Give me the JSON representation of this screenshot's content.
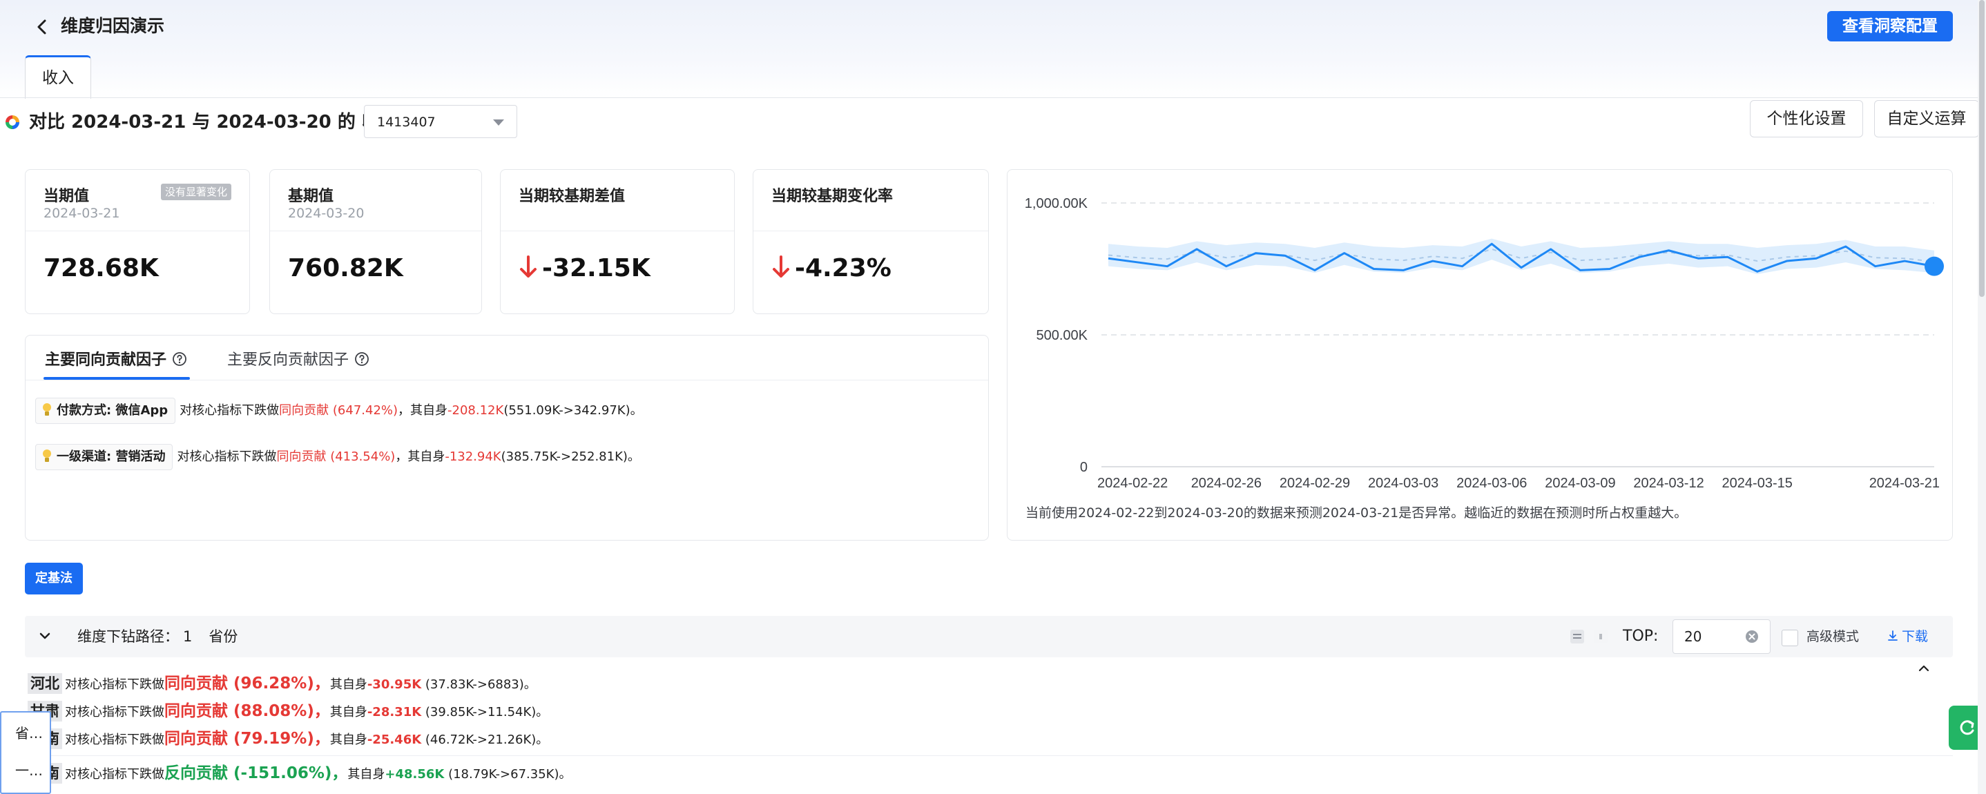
{
  "header": {
    "title": "维度归因演示",
    "config_button": "查看洞察配置"
  },
  "tabs": [
    {
      "label": "收入"
    }
  ],
  "compare": {
    "title": "对比 2024-03-21 与 2024-03-20 的 收入",
    "select_value": "1413407",
    "personalize_button": "个性化设置",
    "custom_calc_button": "自定义运算"
  },
  "metrics": {
    "current": {
      "label": "当期值",
      "date": "2024-03-21",
      "value": "728.68K",
      "badge": "没有显著变化"
    },
    "base": {
      "label": "基期值",
      "date": "2024-03-20",
      "value": "760.82K"
    },
    "diff": {
      "label": "当期较基期差值",
      "value": "-32.15K"
    },
    "rate": {
      "label": "当期较基期变化率",
      "value": "-4.23%"
    }
  },
  "factors": {
    "tab_positive": "主要同向贡献因子",
    "tab_negative": "主要反向贡献因子",
    "rows": [
      {
        "tag": "付款方式: 微信App",
        "prefix": "对核心指标下跌做",
        "contrib": "同向贡献 (647.42%)",
        "mid": "，其自身",
        "delta": "-208.12K",
        "range": "(551.09K->342.97K)。"
      },
      {
        "tag": "一级渠道: 营销活动",
        "prefix": "对核心指标下跌做",
        "contrib": "同向贡献 (413.54%)",
        "mid": "，其自身",
        "delta": "-132.94K",
        "range": "(385.75K->252.81K)。"
      }
    ]
  },
  "chart_data": {
    "type": "line",
    "title": "",
    "xlabel": "",
    "ylabel": "",
    "ylim": [
      0,
      1000
    ],
    "y_ticks": [
      "1,000.00K",
      "500.00K",
      "0"
    ],
    "x_tick_labels": [
      "2024-02-22",
      "2024-02-26",
      "2024-02-29",
      "2024-03-03",
      "2024-03-06",
      "2024-03-09",
      "2024-03-12",
      "2024-03-15",
      "2024-03-21"
    ],
    "x": [
      "2024-02-22",
      "2024-02-23",
      "2024-02-24",
      "2024-02-25",
      "2024-02-26",
      "2024-02-27",
      "2024-02-28",
      "2024-02-29",
      "2024-03-01",
      "2024-03-02",
      "2024-03-03",
      "2024-03-04",
      "2024-03-05",
      "2024-03-06",
      "2024-03-07",
      "2024-03-08",
      "2024-03-09",
      "2024-03-10",
      "2024-03-11",
      "2024-03-12",
      "2024-03-13",
      "2024-03-14",
      "2024-03-15",
      "2024-03-16",
      "2024-03-17",
      "2024-03-18",
      "2024-03-19",
      "2024-03-20",
      "2024-03-21"
    ],
    "series": [
      {
        "values": [
          790,
          775,
          760,
          825,
          760,
          810,
          800,
          745,
          810,
          750,
          745,
          780,
          760,
          845,
          755,
          825,
          745,
          750,
          795,
          820,
          790,
          795,
          740,
          780,
          790,
          835,
          760,
          780,
          760
        ]
      }
    ],
    "band_upper": [
      845,
      835,
      830,
      855,
      840,
      850,
      845,
      830,
      850,
      835,
      830,
      840,
      835,
      865,
      835,
      855,
      830,
      835,
      845,
      855,
      845,
      845,
      830,
      840,
      845,
      860,
      835,
      835,
      820
    ],
    "band_lower": [
      760,
      750,
      745,
      775,
      745,
      765,
      760,
      735,
      765,
      740,
      735,
      755,
      745,
      785,
      745,
      770,
      735,
      740,
      760,
      770,
      755,
      760,
      730,
      750,
      755,
      775,
      750,
      745,
      735
    ],
    "grid": true,
    "legend": "none",
    "line_color": "#1e88f5",
    "band_color": "#d8ebfd",
    "note": "当前使用2024-02-22到2024-03-20的数据来预测2024-03-21是否异常。越临近的数据在预测时所占权重越大。"
  },
  "algo_button": "定基法",
  "drill": {
    "path_label": "维度下钻路径：",
    "path_index": "1",
    "path_dim": "省份",
    "top_label": "TOP:",
    "top_value": "20",
    "advanced_label": "高级模式",
    "download_label": "下载",
    "rows": [
      {
        "tag": "河北",
        "prefix": "对核心指标下跌做",
        "contrib": "同向贡献 (96.28%)，",
        "mid": "其自身",
        "delta": "-30.95K",
        "range": " (37.83K->6883)。",
        "type": "pos"
      },
      {
        "tag": "甘肃",
        "prefix": "对核心指标下跌做",
        "contrib": "同向贡献 (88.08%)，",
        "mid": "其自身",
        "delta": "-28.31K",
        "range": " (39.85K->11.54K)。",
        "type": "pos"
      },
      {
        "tag": "河南",
        "prefix": "对核心指标下跌做",
        "contrib": "同向贡献 (79.19%)，",
        "mid": "其自身",
        "delta": "-25.46K",
        "range": " (46.72K->21.26K)。",
        "type": "pos"
      },
      {
        "tag": "云南",
        "prefix": "对核心指标下跌做",
        "contrib": "反向贡献 (-151.06%)，",
        "mid": "其自身",
        "delta": "+48.56K",
        "range": " (18.79K->67.35K)。",
        "type": "neg"
      }
    ]
  },
  "popup": {
    "items": [
      "省…",
      "一…"
    ]
  },
  "colors": {
    "accent": "#1a6cf2",
    "negative": "#e53935",
    "positive": "#1aa251"
  }
}
